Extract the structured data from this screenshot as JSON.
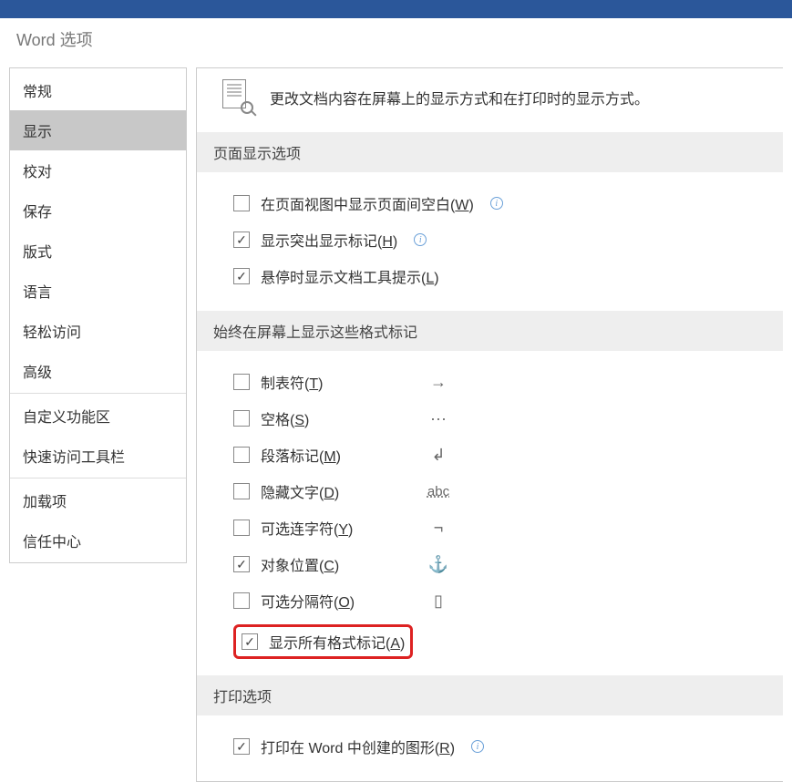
{
  "title": "Word 选项",
  "sidebar": {
    "items": [
      {
        "label": "常规"
      },
      {
        "label": "显示",
        "selected": true
      },
      {
        "label": "校对"
      },
      {
        "label": "保存"
      },
      {
        "label": "版式"
      },
      {
        "label": "语言"
      },
      {
        "label": "轻松访问"
      },
      {
        "label": "高级"
      },
      {
        "label": "自定义功能区"
      },
      {
        "label": "快速访问工具栏"
      },
      {
        "label": "加载项"
      },
      {
        "label": "信任中心"
      }
    ]
  },
  "description": "更改文档内容在屏幕上的显示方式和在打印时的显示方式。",
  "sections": {
    "page_display": {
      "header": "页面显示选项",
      "opts": [
        {
          "checked": false,
          "label_pre": "在页面视图中显示页面间空白(",
          "hotkey": "W",
          "label_post": ")",
          "info": true
        },
        {
          "checked": true,
          "label_pre": "显示突出显示标记(",
          "hotkey": "H",
          "label_post": ")",
          "info": true
        },
        {
          "checked": true,
          "label_pre": "悬停时显示文档工具提示(",
          "hotkey": "L",
          "label_post": ")",
          "info": false
        }
      ]
    },
    "format_marks": {
      "header": "始终在屏幕上显示这些格式标记",
      "opts": [
        {
          "checked": false,
          "label_pre": "制表符(",
          "hotkey": "T",
          "label_post": ")",
          "sym": "→"
        },
        {
          "checked": false,
          "label_pre": "空格(",
          "hotkey": "S",
          "label_post": ")",
          "sym": "···"
        },
        {
          "checked": false,
          "label_pre": "段落标记(",
          "hotkey": "M",
          "label_post": ")",
          "sym": "↲"
        },
        {
          "checked": false,
          "label_pre": "隐藏文字(",
          "hotkey": "D",
          "label_post": ")",
          "sym": "abc",
          "sym_class": "abc"
        },
        {
          "checked": false,
          "label_pre": "可选连字符(",
          "hotkey": "Y",
          "label_post": ")",
          "sym": "¬"
        },
        {
          "checked": true,
          "label_pre": "对象位置(",
          "hotkey": "C",
          "label_post": ")",
          "sym": "⚓"
        },
        {
          "checked": false,
          "label_pre": "可选分隔符(",
          "hotkey": "O",
          "label_post": ")",
          "sym": "▯"
        }
      ],
      "show_all": {
        "checked": true,
        "label_pre": "显示所有格式标记(",
        "hotkey": "A",
        "label_post": ")",
        "highlighted": true
      }
    },
    "print": {
      "header": "打印选项",
      "opts": [
        {
          "checked": true,
          "label_pre": "打印在 Word 中创建的图形(",
          "hotkey": "R",
          "label_post": ")",
          "info": true
        }
      ]
    }
  }
}
